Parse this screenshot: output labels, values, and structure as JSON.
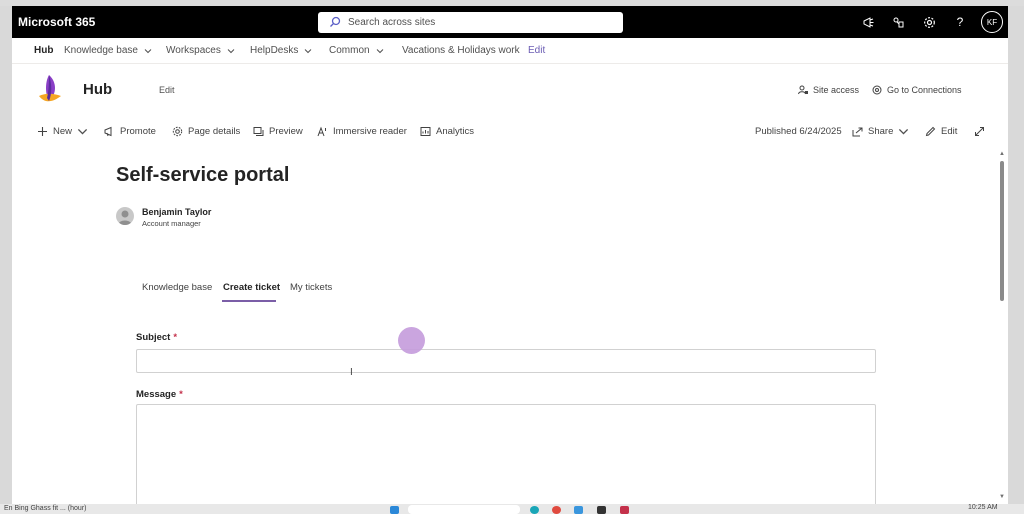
{
  "suite": {
    "title": "Microsoft 365",
    "search_placeholder": "Search across sites",
    "avatar_initials": "KF",
    "icons": [
      "megaphone-icon",
      "share-icon",
      "gear-icon",
      "help-icon"
    ]
  },
  "hub_nav": {
    "hub_name": "Hub",
    "items": [
      {
        "label": "Knowledge base",
        "has_dropdown": true
      },
      {
        "label": "Workspaces",
        "has_dropdown": true
      },
      {
        "label": "HelpDesks",
        "has_dropdown": true
      },
      {
        "label": "Common",
        "has_dropdown": true
      },
      {
        "label": "Vacations & Holidays work",
        "has_dropdown": false
      }
    ],
    "edit_label": "Edit"
  },
  "site": {
    "title": "Hub",
    "edit_label": "Edit",
    "site_access_label": "Site access",
    "go_to_connections_label": "Go to Connections"
  },
  "command_bar": {
    "new_label": "New",
    "promote_label": "Promote",
    "page_details_label": "Page details",
    "preview_label": "Preview",
    "immersive_reader_label": "Immersive reader",
    "analytics_label": "Analytics",
    "published_label": "Published 6/24/2025",
    "share_label": "Share",
    "edit_label": "Edit"
  },
  "page": {
    "title": "Self-service portal",
    "author_name": "Benjamin Taylor",
    "author_role": "Account manager",
    "tabs": [
      {
        "label": "Knowledge base",
        "active": false
      },
      {
        "label": "Create ticket",
        "active": true
      },
      {
        "label": "My tickets",
        "active": false
      }
    ],
    "form": {
      "subject_label": "Subject",
      "message_label": "Message",
      "required_marker": "*",
      "subject_value": "",
      "message_value": ""
    }
  },
  "taskbar": {
    "window_label": "En Bing Ghass fit ... (hour)",
    "time": "10:25 AM"
  },
  "colors": {
    "suite_bar": "#000000",
    "accent": "#7b5ea7",
    "required": "#c4314b",
    "cursor_highlight": "#c49bdc"
  }
}
